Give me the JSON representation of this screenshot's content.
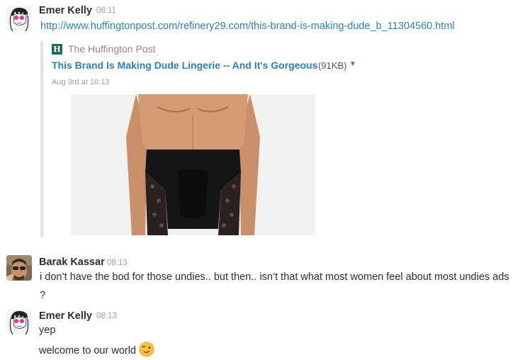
{
  "messages": [
    {
      "author": "Emer Kelly",
      "time": "08:11",
      "link": "http://www.huffingtonpost.com/refinery29.com/this-brand-is-making-dude_b_11304560.html",
      "attachment": {
        "service_icon_letter": "H",
        "service_name": "The Huffington Post",
        "title": "This Brand Is Making Dude Lingerie -- And It's Gorgeous",
        "size": "(91KB)",
        "date": "Aug 3rd at 10:13"
      }
    },
    {
      "author": "Barak Kassar",
      "time": "08:13",
      "lines": [
        "i don’t have the bod for those undies.. but then.. isn’t that what most women feel about most undies ads",
        "?"
      ]
    },
    {
      "author": "Emer Kelly",
      "time": "08:13",
      "lines": [
        "yep",
        "welcome to our world"
      ],
      "emoji": "winking-face"
    }
  ],
  "colors": {
    "link": "#2a80b9",
    "service_icon": "#1f6b5a",
    "timestamp": "#9e9ea6"
  }
}
